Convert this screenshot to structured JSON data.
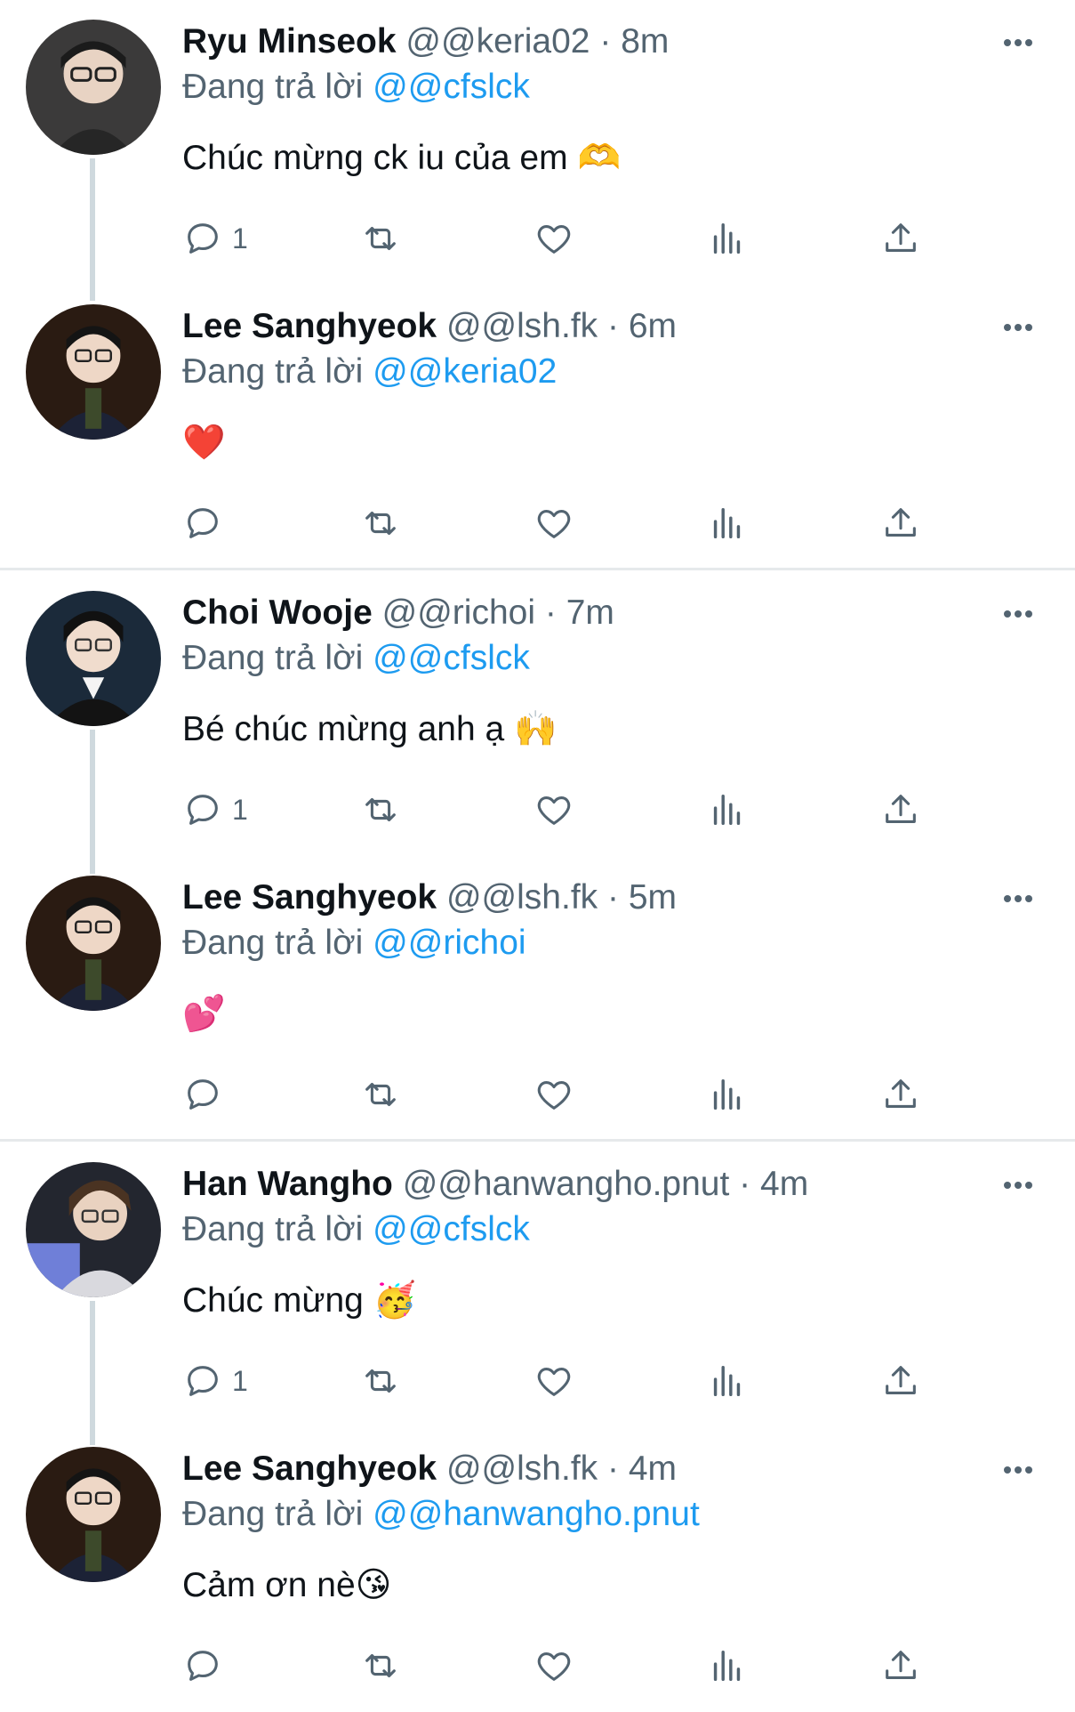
{
  "reply_prefix": "Đang trả lời",
  "tweets": [
    {
      "name": "Ryu Minseok",
      "handle": "@@keria02",
      "dot": "·",
      "time": "8m",
      "replying_to": "@@cfslck",
      "text": "Chúc mừng ck iu của em",
      "emoji": "🫶",
      "reply_count": "1"
    },
    {
      "name": "Lee Sanghyeok",
      "handle": "@@lsh.fk",
      "dot": "·",
      "time": "6m",
      "replying_to": "@@keria02",
      "text": "",
      "emoji": "❤️",
      "reply_count": ""
    },
    {
      "name": "Choi Wooje",
      "handle": "@@richoi",
      "dot": "·",
      "time": "7m",
      "replying_to": "@@cfslck",
      "text": "Bé chúc mừng anh ạ",
      "emoji": "🙌",
      "reply_count": "1"
    },
    {
      "name": "Lee Sanghyeok",
      "handle": "@@lsh.fk",
      "dot": "·",
      "time": "5m",
      "replying_to": "@@richoi",
      "text": "",
      "emoji": "💕",
      "reply_count": ""
    },
    {
      "name": "Han Wangho",
      "handle": "@@hanwangho.pnut",
      "dot": "·",
      "time": "4m",
      "replying_to": "@@cfslck",
      "text": "Chúc mừng",
      "emoji": "🥳",
      "reply_count": "1"
    },
    {
      "name": "Lee Sanghyeok",
      "handle": "@@lsh.fk",
      "dot": "·",
      "time": "4m",
      "replying_to": "@@hanwangho.pnut",
      "text": "Cảm ơn nè",
      "emoji": "😘",
      "reply_count": ""
    }
  ],
  "icons": {
    "reply": "reply-icon",
    "retweet": "retweet-icon",
    "like": "heart-icon",
    "views": "views-icon",
    "share": "share-icon",
    "more": "more-icon"
  },
  "colors": {
    "link": "#1d9bf0",
    "secondary_text": "#536471",
    "thread_line": "#cfd9de",
    "divider": "#e6e9eb"
  }
}
